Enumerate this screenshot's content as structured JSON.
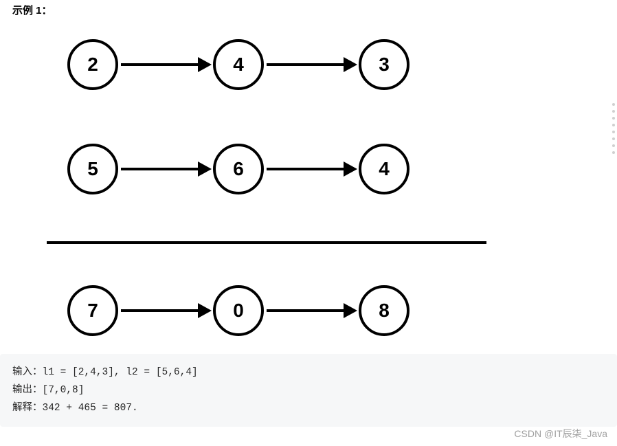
{
  "title": "示例 1：",
  "lists": {
    "l1": [
      "2",
      "4",
      "3"
    ],
    "l2": [
      "5",
      "6",
      "4"
    ],
    "result": [
      "7",
      "0",
      "8"
    ]
  },
  "output": {
    "line1": "输入：l1 = [2,4,3], l2 = [5,6,4]",
    "line2": "输出：[7,0,8]",
    "line3": "解释：342 + 465 = 807."
  },
  "watermark": "CSDN @IT辰柒_Java"
}
